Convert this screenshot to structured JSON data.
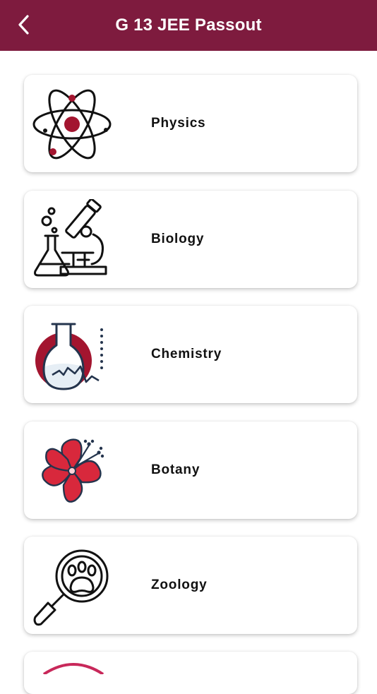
{
  "header": {
    "title": "G 13 JEE Passout",
    "back_icon": "chevron-left-icon",
    "background": "#7e1b3e"
  },
  "subjects": [
    {
      "label": "Physics",
      "icon": "atom-icon"
    },
    {
      "label": "Biology",
      "icon": "microscope-icon"
    },
    {
      "label": "Chemistry",
      "icon": "flask-icon"
    },
    {
      "label": "Botany",
      "icon": "flower-icon"
    },
    {
      "label": "Zoology",
      "icon": "paw-magnifier-icon"
    }
  ],
  "colors": {
    "accent": "#7e1b3e",
    "icon_red": "#a3152f",
    "flower_red": "#d8283c",
    "navy": "#24344d"
  }
}
